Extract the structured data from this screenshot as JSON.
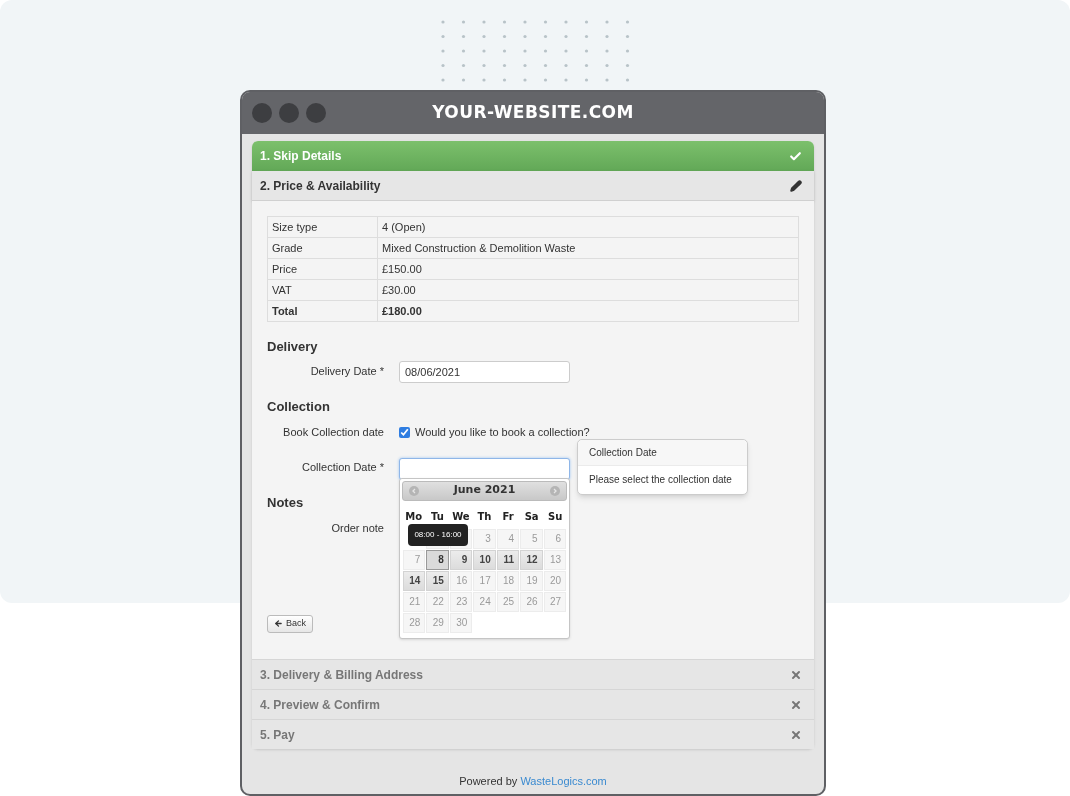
{
  "window": {
    "title": "YOUR-WEBSITE.COM"
  },
  "steps": [
    {
      "label": "1. Skip Details",
      "kind": "done"
    },
    {
      "label": "2. Price & Availability",
      "kind": "editing"
    },
    {
      "label": "3. Delivery & Billing Address",
      "kind": "locked"
    },
    {
      "label": "4. Preview & Confirm",
      "kind": "locked"
    },
    {
      "label": "5. Pay",
      "kind": "locked"
    }
  ],
  "summary_table": [
    {
      "label": "Size type",
      "value": "4 (Open)",
      "bold": false
    },
    {
      "label": "Grade",
      "value": "Mixed Construction & Demolition Waste",
      "bold": false
    },
    {
      "label": "Price",
      "value": "£150.00",
      "bold": false
    },
    {
      "label": "VAT",
      "value": "£30.00",
      "bold": false
    },
    {
      "label": "Total",
      "value": "£180.00",
      "bold": true
    }
  ],
  "delivery": {
    "heading": "Delivery",
    "date_label": "Delivery Date *",
    "date_value": "08/06/2021"
  },
  "collection": {
    "heading": "Collection",
    "book_label": "Book Collection date",
    "checkbox": {
      "label": "Would you like to book a collection?",
      "checked": true
    },
    "date_label": "Collection Date *"
  },
  "popover": {
    "title": "Collection Date",
    "text": "Please select the collection date"
  },
  "datepicker": {
    "month": "June 2021",
    "weekdays": [
      "Mo",
      "Tu",
      "We",
      "Th",
      "Fr",
      "Sa",
      "Su"
    ],
    "tooltip": "08:00 - 16:00",
    "weeks": [
      [
        {
          "kind": "empty"
        },
        {
          "kind": "covered"
        },
        {
          "kind": "covered"
        },
        {
          "kind": "disabled",
          "day": "3"
        },
        {
          "kind": "disabled",
          "day": "4"
        },
        {
          "kind": "disabled",
          "day": "5"
        },
        {
          "kind": "disabled",
          "day": "6"
        }
      ],
      [
        {
          "kind": "disabled",
          "day": "7"
        },
        {
          "kind": "hovered",
          "day": "8"
        },
        {
          "kind": "available",
          "day": "9"
        },
        {
          "kind": "available",
          "day": "10"
        },
        {
          "kind": "available",
          "day": "11"
        },
        {
          "kind": "available",
          "day": "12"
        },
        {
          "kind": "disabled",
          "day": "13"
        }
      ],
      [
        {
          "kind": "available",
          "day": "14"
        },
        {
          "kind": "available",
          "day": "15"
        },
        {
          "kind": "disabled",
          "day": "16"
        },
        {
          "kind": "disabled",
          "day": "17"
        },
        {
          "kind": "disabled",
          "day": "18"
        },
        {
          "kind": "disabled",
          "day": "19"
        },
        {
          "kind": "disabled",
          "day": "20"
        }
      ],
      [
        {
          "kind": "disabled",
          "day": "21"
        },
        {
          "kind": "disabled",
          "day": "22"
        },
        {
          "kind": "disabled",
          "day": "23"
        },
        {
          "kind": "disabled",
          "day": "24"
        },
        {
          "kind": "disabled",
          "day": "25"
        },
        {
          "kind": "disabled",
          "day": "26"
        },
        {
          "kind": "disabled",
          "day": "27"
        }
      ],
      [
        {
          "kind": "disabled",
          "day": "28"
        },
        {
          "kind": "disabled",
          "day": "29"
        },
        {
          "kind": "disabled",
          "day": "30"
        }
      ]
    ]
  },
  "notes": {
    "heading": "Notes",
    "order_note_label": "Order note"
  },
  "back_button": "Back",
  "footer": {
    "prefix": "Powered by",
    "link": "WasteLogics.com"
  }
}
